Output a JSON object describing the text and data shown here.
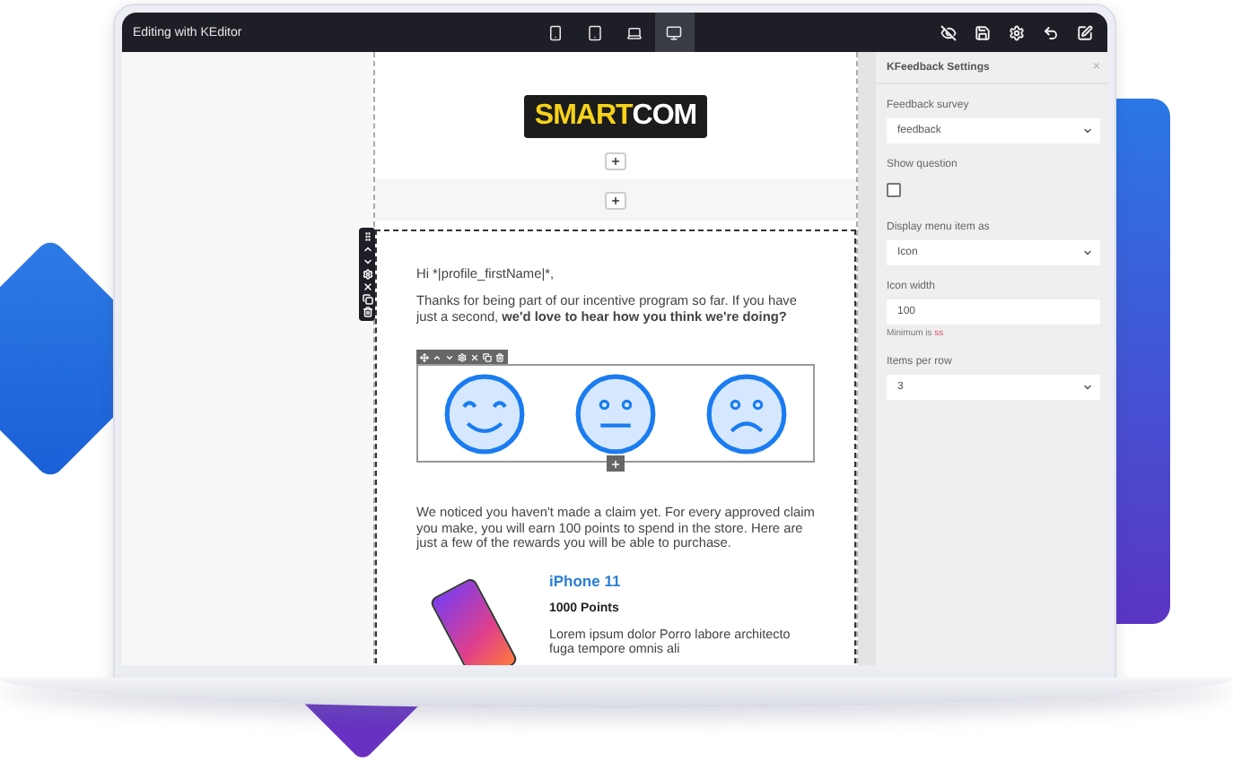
{
  "window": {
    "title": "Editing with KEditor"
  },
  "devices": [
    {
      "kind": "phone",
      "selected": false
    },
    {
      "kind": "tablet",
      "selected": false
    },
    {
      "kind": "laptop",
      "selected": false
    },
    {
      "kind": "desktop",
      "selected": true
    }
  ],
  "toolbar": [
    {
      "kind": "hide"
    },
    {
      "kind": "save"
    },
    {
      "kind": "settings"
    },
    {
      "kind": "undo"
    },
    {
      "kind": "edit"
    }
  ],
  "email": {
    "logo": {
      "part_1": "SMART",
      "part_2": "COM"
    },
    "greeting": "Hi *|profile_firstName|*,",
    "intro": "Thanks for being part of our incentive program so far.  If you have just a second, **we'd love to hear how you think we're doing?**",
    "faces": [
      {
        "kind": "happy"
      },
      {
        "kind": "neutral"
      },
      {
        "kind": "sad"
      }
    ],
    "claim": "We noticed you haven't made a claim yet.  For every approved claim you make, you will earn 100 points to spend in the store. Here are just a few of the rewards you will be able to purchase.",
    "product": {
      "name": "iPhone 11",
      "points": "1000 Points",
      "description": "Lorem ipsum dolor Porro labore architecto fuga tempore omnis ali"
    }
  },
  "settings": {
    "title": "KFeedback Settings",
    "close": "×",
    "fields": [
      {
        "kind": "select",
        "label": "Feedback survey",
        "value": "feedback"
      },
      {
        "kind": "checkbox",
        "label": "Show question",
        "checked": false
      },
      {
        "kind": "select",
        "label": "Display menu item as",
        "value": "Icon"
      },
      {
        "kind": "input",
        "label": "Icon width",
        "value": "100",
        "hint": "Minimum is",
        "hint_mark": "ss"
      },
      {
        "kind": "select",
        "label": "Items per row",
        "value": "3"
      }
    ]
  }
}
